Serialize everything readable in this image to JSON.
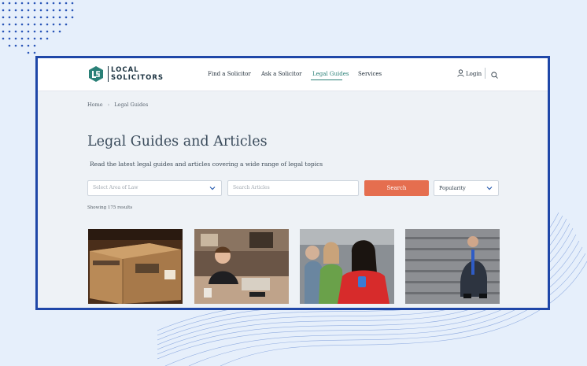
{
  "brand": {
    "line1": "LOCAL",
    "line2": "SOLICITORS",
    "accent": "#2a8077"
  },
  "nav": {
    "items": [
      {
        "label": "Find a Solicitor"
      },
      {
        "label": "Ask a Solicitor"
      },
      {
        "label": "Legal Guides",
        "active": true
      },
      {
        "label": "Services"
      }
    ],
    "login_label": "Login"
  },
  "breadcrumb": {
    "home": "Home",
    "separator": "›",
    "current": "Legal Guides"
  },
  "page": {
    "title": "Legal Guides and Articles",
    "subtitle": "Read the latest legal guides and articles covering a wide range of legal topics"
  },
  "filters": {
    "area_placeholder": "Select Area of Law",
    "search_placeholder": "Search Articles",
    "search_button": "Search",
    "sort_value": "Popularity",
    "button_color": "#e56e4f"
  },
  "results_text": "Showing 175 results",
  "frame_color": "#1f47a8"
}
